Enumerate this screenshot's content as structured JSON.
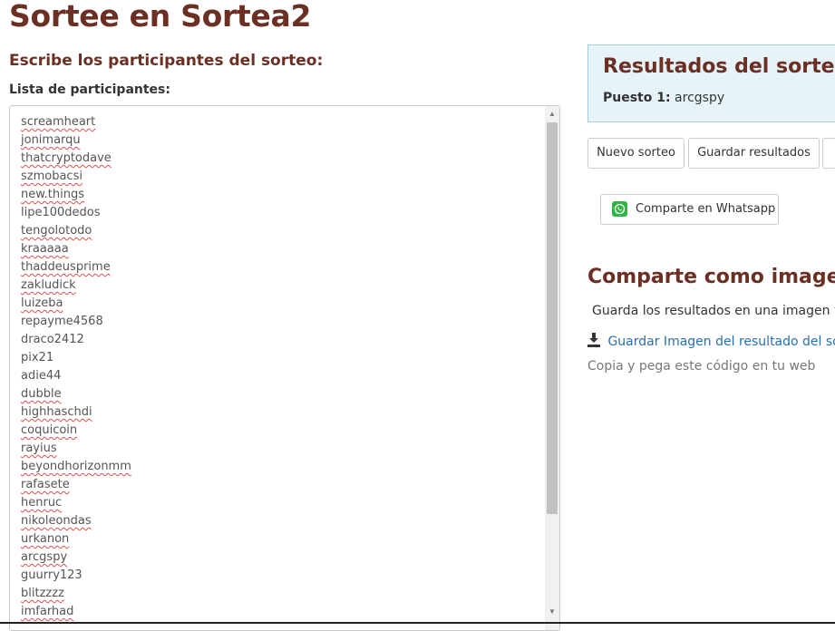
{
  "header": {
    "title": "Sortee en Sortea2"
  },
  "form": {
    "section_title": "Escribe los participantes del sorteo:",
    "list_label": "Lista de participantes:",
    "participants": [
      {
        "name": "screamheart",
        "misspelled": true
      },
      {
        "name": "jonimarqu",
        "misspelled": true
      },
      {
        "name": "thatcryptodave",
        "misspelled": true
      },
      {
        "name": "szmobacsi",
        "misspelled": true
      },
      {
        "name": "new.things",
        "misspelled": true
      },
      {
        "name": "lipe100dedos",
        "misspelled": false
      },
      {
        "name": "tengolotodo",
        "misspelled": true
      },
      {
        "name": "kraaaaa",
        "misspelled": true
      },
      {
        "name": "thaddeusprime",
        "misspelled": true
      },
      {
        "name": "zakludick",
        "misspelled": true
      },
      {
        "name": "luizeba",
        "misspelled": true
      },
      {
        "name": "repayme4568",
        "misspelled": false
      },
      {
        "name": "draco2412",
        "misspelled": false
      },
      {
        "name": "pix21",
        "misspelled": false
      },
      {
        "name": "adie44",
        "misspelled": false
      },
      {
        "name": "dubble",
        "misspelled": true
      },
      {
        "name": "highhaschdi",
        "misspelled": true
      },
      {
        "name": "coquicoin",
        "misspelled": true
      },
      {
        "name": "rayius",
        "misspelled": true
      },
      {
        "name": "beyondhorizonmm",
        "misspelled": true
      },
      {
        "name": "rafasete",
        "misspelled": true
      },
      {
        "name": "henruc",
        "misspelled": true
      },
      {
        "name": "nikoleondas",
        "misspelled": true
      },
      {
        "name": "urkanon",
        "misspelled": true
      },
      {
        "name": "arcgspy",
        "misspelled": true
      },
      {
        "name": "guurry123",
        "misspelled": false
      },
      {
        "name": "blitzzzz",
        "misspelled": true
      },
      {
        "name": "imfarhad",
        "misspelled": true
      }
    ]
  },
  "results": {
    "title": "Resultados del sorteo",
    "position_label": "Puesto 1:",
    "winner": "arcgspy"
  },
  "actions": {
    "new_draw": "Nuevo sorteo",
    "save_results": "Guardar resultados",
    "whatsapp": "Comparte en Whatsapp"
  },
  "share_image": {
    "title": "Comparte como imagen",
    "description": "Guarda los resultados en una imagen y",
    "download_link": "Guardar Imagen del resultado del sor",
    "embed_text": "Copia y pega este código en tu web"
  },
  "colors": {
    "heading": "#6b2f23",
    "results_bg": "#e6f3f8",
    "results_border": "#9ed0e6",
    "whatsapp": "#2fb544",
    "link": "#2a6fb0"
  },
  "icons": {
    "whatsapp": "whatsapp-icon",
    "download": "download-icon",
    "scroll_up": "scroll-up-arrow",
    "scroll_down": "scroll-down-arrow"
  }
}
